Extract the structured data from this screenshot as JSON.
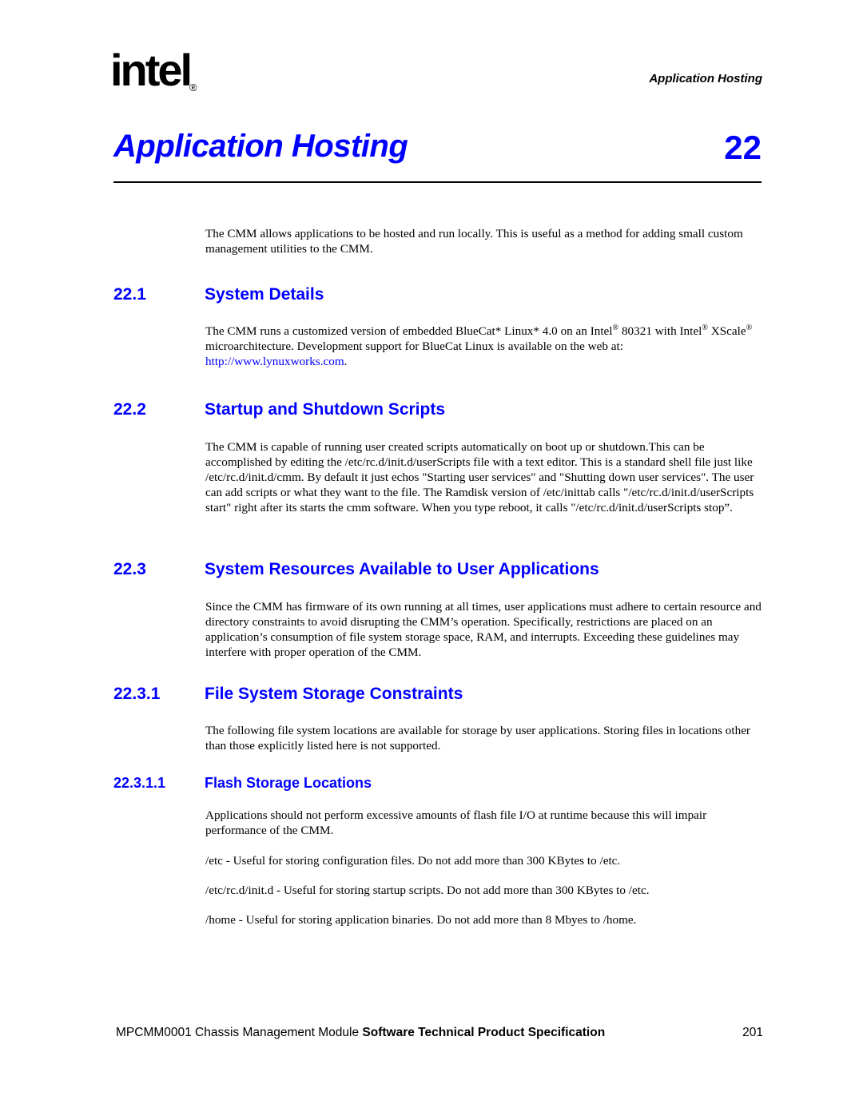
{
  "header": {
    "logo_text": "intel",
    "logo_mark": "®",
    "running_title": "Application Hosting"
  },
  "chapter": {
    "title": "Application Hosting",
    "number": "22",
    "intro": "The CMM allows applications to be hosted and run locally. This is useful as a method for adding small custom management utilities to the CMM."
  },
  "sections": {
    "s1": {
      "number": "22.1",
      "title": "System Details",
      "text_a": "The CMM runs a customized version of embedded BlueCat* Linux* 4.0 on an Intel",
      "reg1": "®",
      "text_b": " 80321 with Intel",
      "reg2": "®",
      "text_c": " XScale",
      "reg3": "®",
      "text_d": " microarchitecture. Development support for BlueCat Linux is available on the web at: ",
      "link": "http://www.lynuxworks.com",
      "text_e": "."
    },
    "s2": {
      "number": "22.2",
      "title": "Startup and Shutdown Scripts",
      "text": "The CMM is capable of running user created scripts automatically on boot up or shutdown.This can be accomplished by editing the /etc/rc.d/init.d/userScripts file with a text editor. This is a standard shell file just like /etc/rc.d/init.d/cmm. By default it just echos \"Starting user services\" and \"Shutting down user services\". The user can add scripts or what they want to the file. The Ramdisk version of /etc/inittab calls \"/etc/rc.d/init.d/userScripts start\" right after its starts the cmm software. When you type reboot, it calls \"/etc/rc.d/init.d/userScripts stop”."
    },
    "s3": {
      "number": "22.3",
      "title": "System Resources Available to User Applications",
      "text": "Since the CMM has firmware of its own running at all times, user applications must adhere to certain resource and directory constraints to avoid disrupting the CMM’s operation. Specifically, restrictions are placed on an application’s consumption of file system storage space, RAM, and interrupts. Exceeding these guidelines may interfere with proper operation of the CMM."
    },
    "s31": {
      "number": "22.3.1",
      "title": "File System Storage Constraints",
      "text": "The following file system locations are available for storage by user applications. Storing files in locations other than those explicitly listed here is not supported."
    },
    "s311": {
      "number": "22.3.1.1",
      "title": "Flash Storage Locations",
      "text": "Applications should not perform excessive amounts of flash file I/O at runtime because this will impair performance of the CMM.",
      "items": [
        "/etc - Useful for storing configuration files. Do not add more than 300 KBytes to /etc.",
        "/etc/rc.d/init.d - Useful for storing startup scripts. Do not add more than 300 KBytes to /etc.",
        "/home - Useful for storing application binaries. Do not add more than 8 Mbyes to /home."
      ]
    }
  },
  "footer": {
    "doc_prefix": "MPCMM0001 Chassis Management Module ",
    "doc_bold": "Software Technical Product Specification",
    "page_number": "201"
  }
}
